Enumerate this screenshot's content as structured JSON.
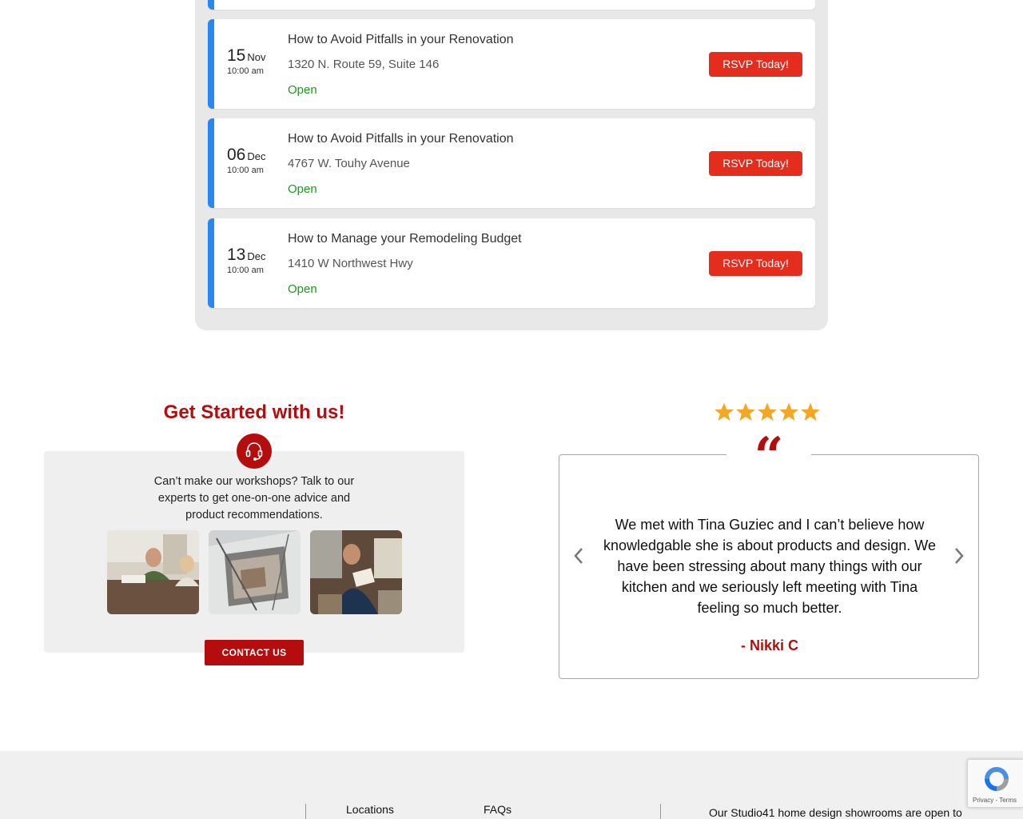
{
  "events": [
    {
      "day": "15",
      "month": "Nov",
      "time": "10:00 am",
      "title": "How to Avoid Pitfalls in your Renovation",
      "address": "1320 N. Route 59, Suite 146",
      "status": "Open",
      "button": "RSVP Today!"
    },
    {
      "day": "06",
      "month": "Dec",
      "time": "10:00 am",
      "title": "How to Avoid Pitfalls in your Renovation",
      "address": "4767 W. Touhy Avenue",
      "status": "Open",
      "button": "RSVP Today!"
    },
    {
      "day": "13",
      "month": "Dec",
      "time": "10:00 am",
      "title": "How to Manage your Remodeling Budget",
      "address": "1410 W Northwest Hwy",
      "status": "Open",
      "button": "RSVP Today!"
    }
  ],
  "get_started": {
    "title": "Get Started with us!",
    "icon": "headset-icon",
    "text": "Can’t make our workshops? Talk to our experts to get one-on-one advice and product recommendations.",
    "contact_label": "CONTACT US"
  },
  "testimonial": {
    "rating": 5,
    "quote_mark": "“",
    "text": "We met with Tina Guziec and I can’t believe how knowledgable she is about products and design. We have been stressing about many things with our kitchen and we seriously left meeting with Tina feeling so much better.",
    "author": "- Nikki C"
  },
  "footer": {
    "links": [
      "Locations",
      "FAQs"
    ],
    "text": "Our Studio41 home design showrooms are open to"
  },
  "recaptcha": {
    "privacy": "Privacy",
    "terms": "Terms"
  },
  "colors": {
    "brand_red": "#b50d0d",
    "rsvp_red": "#e52d1e",
    "event_accent": "#2a86f0",
    "open_green": "#1a9a1a",
    "star_gold": "#f5a623"
  }
}
